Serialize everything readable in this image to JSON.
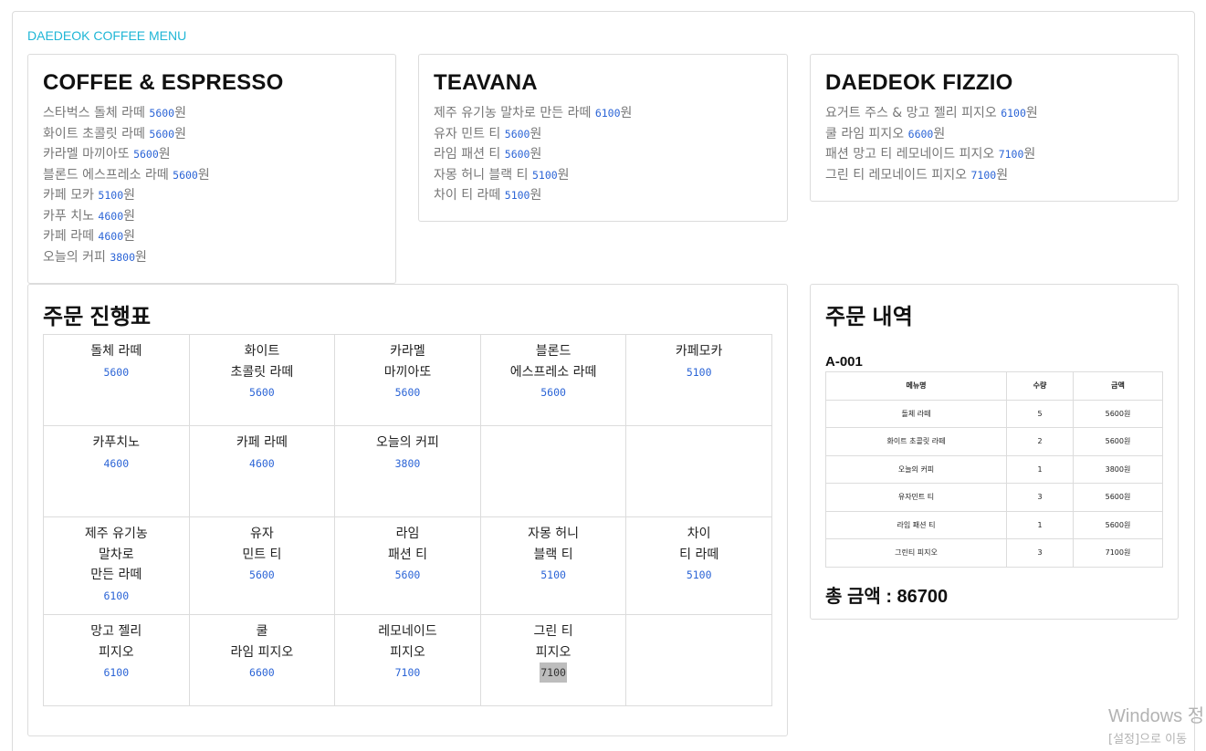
{
  "brand": "DAEDEOK COFFEE MENU",
  "currency": "원",
  "colors": {
    "brand": "#1fb6d6",
    "price": "#2b64d6"
  },
  "menus": [
    {
      "title": "COFFEE & ESPRESSO",
      "items": [
        {
          "name": "스타벅스 돌체 라떼",
          "price": "5600"
        },
        {
          "name": "화이트 초콜릿 라떼",
          "price": "5600"
        },
        {
          "name": "카라멜 마끼아또",
          "price": "5600"
        },
        {
          "name": "블론드 에스프레소 라떼",
          "price": "5600"
        },
        {
          "name": "카페 모카",
          "price": "5100"
        },
        {
          "name": "카푸 치노",
          "price": "4600"
        },
        {
          "name": "카페 라떼",
          "price": "4600"
        },
        {
          "name": "오늘의 커피",
          "price": "3800"
        }
      ]
    },
    {
      "title": "TEAVANA",
      "items": [
        {
          "name": "제주 유기농 말차로 만든 라떼",
          "price": "6100"
        },
        {
          "name": "유자 민트 티",
          "price": "5600"
        },
        {
          "name": "라임 패션 티",
          "price": "5600"
        },
        {
          "name": "자몽 허니 블랙 티",
          "price": "5100"
        },
        {
          "name": "차이 티 라떼",
          "price": "5100"
        }
      ]
    },
    {
      "title": "DAEDEOK FIZZIO",
      "items": [
        {
          "name": "요거트 주스 & 망고 젤리 피지오",
          "price": "6100"
        },
        {
          "name": "쿨 라임 피지오",
          "price": "6600"
        },
        {
          "name": "패션 망고 티 레모네이드 피지오",
          "price": "7100"
        },
        {
          "name": "그린 티 레모네이드 피지오",
          "price": "7100"
        }
      ]
    }
  ],
  "progress": {
    "title": "주문 진행표",
    "rows": [
      [
        {
          "lines": [
            "돌체 라떼"
          ],
          "price": "5600"
        },
        {
          "lines": [
            "화이트",
            "초콜릿 라떼"
          ],
          "price": "5600"
        },
        {
          "lines": [
            "카라멜",
            "마끼아또"
          ],
          "price": "5600"
        },
        {
          "lines": [
            "블론드",
            "에스프레소 라떼"
          ],
          "price": "5600"
        },
        {
          "lines": [
            "카페모카"
          ],
          "price": "5100"
        }
      ],
      [
        {
          "lines": [
            "카푸치노"
          ],
          "price": "4600"
        },
        {
          "lines": [
            "카페 라떼"
          ],
          "price": "4600"
        },
        {
          "lines": [
            "오늘의 커피"
          ],
          "price": "3800"
        },
        null,
        null
      ],
      [
        {
          "lines": [
            "제주 유기농",
            "말차로",
            "만든 라떼"
          ],
          "price": "6100"
        },
        {
          "lines": [
            "유자",
            "민트 티"
          ],
          "price": "5600"
        },
        {
          "lines": [
            "라임",
            "패션 티"
          ],
          "price": "5600"
        },
        {
          "lines": [
            "자몽 허니",
            "블랙 티"
          ],
          "price": "5100"
        },
        {
          "lines": [
            "차이",
            "티 라떼"
          ],
          "price": "5100"
        }
      ],
      [
        {
          "lines": [
            "망고 젤리",
            "피지오"
          ],
          "price": "6100"
        },
        {
          "lines": [
            "쿨",
            "라임 피지오"
          ],
          "price": "6600"
        },
        {
          "lines": [
            "레모네이드",
            "피지오"
          ],
          "price": "7100"
        },
        {
          "lines": [
            "그린 티",
            "피지오"
          ],
          "price": "7100",
          "highlight": true
        },
        null
      ]
    ]
  },
  "order": {
    "title": "주문 내역",
    "order_id": "A-001",
    "headers": [
      "메뉴명",
      "수량",
      "금액"
    ],
    "rows": [
      [
        "돌체 라떼",
        "5",
        "5600원"
      ],
      [
        "화이트 초콜릿 라떼",
        "2",
        "5600원"
      ],
      [
        "오늘의 커피",
        "1",
        "3800원"
      ],
      [
        "유자민트 티",
        "3",
        "5600원"
      ],
      [
        "라임 패션 티",
        "1",
        "5600원"
      ],
      [
        "그린티 피지오",
        "3",
        "7100원"
      ]
    ],
    "total_label": "총 금액 : 86700"
  },
  "watermark": {
    "line1": "Windows 정",
    "line2": "[설정]으로 이동"
  }
}
